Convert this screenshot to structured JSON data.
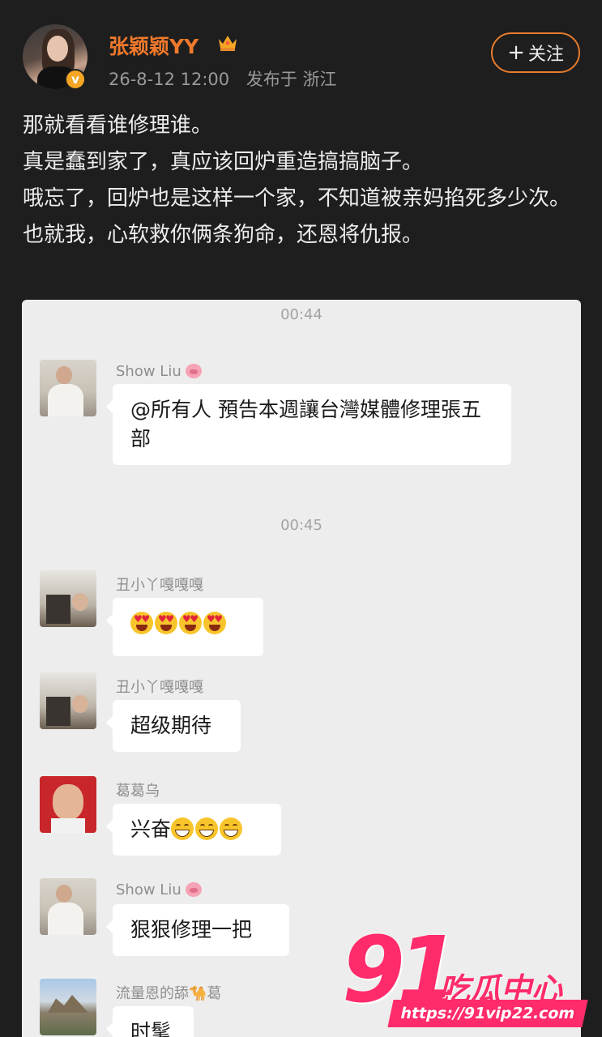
{
  "post": {
    "username": "张颖颖YY",
    "date": "26-8-12 12:00",
    "location": "发布于 浙江",
    "follow_label": "关注",
    "paragraphs": [
      "那就看看谁修理谁。",
      "真是蠢到家了，真应该回炉重造搞搞脑子。",
      "哦忘了，回炉也是这样一个家，不知道被亲妈掐死多少次。也就我，心软救你俩条狗命，还恩将仇报。"
    ]
  },
  "chat": {
    "time1": "00:44",
    "time2": "00:45",
    "messages": [
      {
        "sender": "Show Liu",
        "text": "@所有人  預告本週讓台灣媒體修理張五部"
      },
      {
        "sender": "丑小丫嘎嘎嘎",
        "text": ""
      },
      {
        "sender": "丑小丫嘎嘎嘎",
        "text": "超级期待"
      },
      {
        "sender": "葛葛乌",
        "text": "兴奋"
      },
      {
        "sender": "Show Liu",
        "text": "狠狠修理一把"
      },
      {
        "sender": "流量恩的舔",
        "sender_suffix": "葛",
        "text": "时髦"
      }
    ]
  },
  "watermark": {
    "number": "91",
    "name": "吃瓜中心",
    "url": "https://91vip22.com"
  },
  "colors": {
    "username": "#f0792b",
    "follow_border": "#e77b2d",
    "watermark": "#ff2b6a"
  }
}
